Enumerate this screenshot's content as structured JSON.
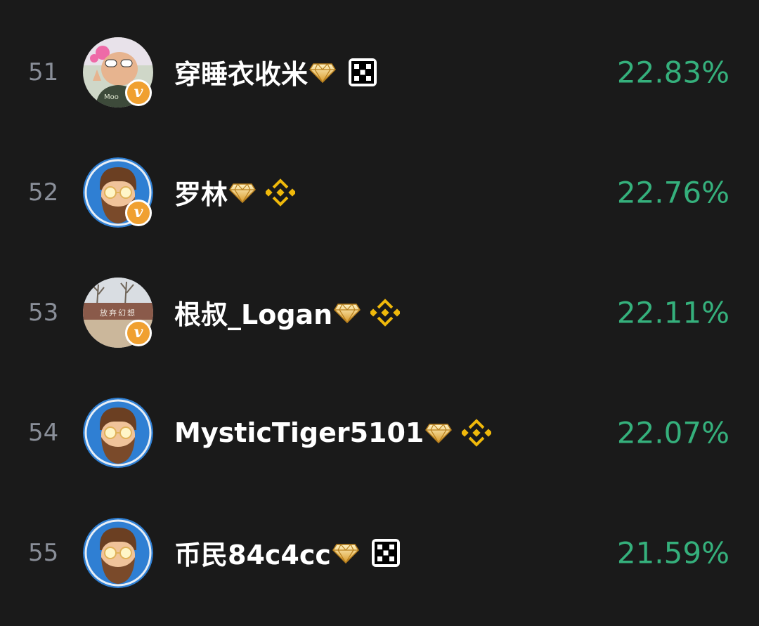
{
  "leaderboard": {
    "rows": [
      {
        "rank": "51",
        "name": "穿睡衣收米",
        "percent": "22.83%",
        "exchange_icon": "okx-icon",
        "avatar_icon": "baby-sunglasses-avatar"
      },
      {
        "rank": "52",
        "name": "罗林",
        "percent": "22.76%",
        "exchange_icon": "binance-icon",
        "avatar_icon": "bearded-man-avatar"
      },
      {
        "rank": "53",
        "name": "根叔_Logan",
        "percent": "22.11%",
        "exchange_icon": "binance-icon",
        "avatar_icon": "landscape-avatar",
        "avatar_text": "放弃幻想"
      },
      {
        "rank": "54",
        "name": "MysticTiger5101",
        "percent": "22.07%",
        "exchange_icon": "binance-icon",
        "avatar_icon": "bearded-man-avatar"
      },
      {
        "rank": "55",
        "name": "币民84c4cc",
        "percent": "21.59%",
        "exchange_icon": "okx-icon",
        "avatar_icon": "bearded-man-avatar"
      }
    ],
    "badge_letter": "v",
    "colors": {
      "background": "#1a1a1a",
      "rank": "#8a8f99",
      "name": "#ffffff",
      "percent": "#35b07c",
      "vip_badge": "#f0a030",
      "binance": "#f0b90b"
    }
  }
}
